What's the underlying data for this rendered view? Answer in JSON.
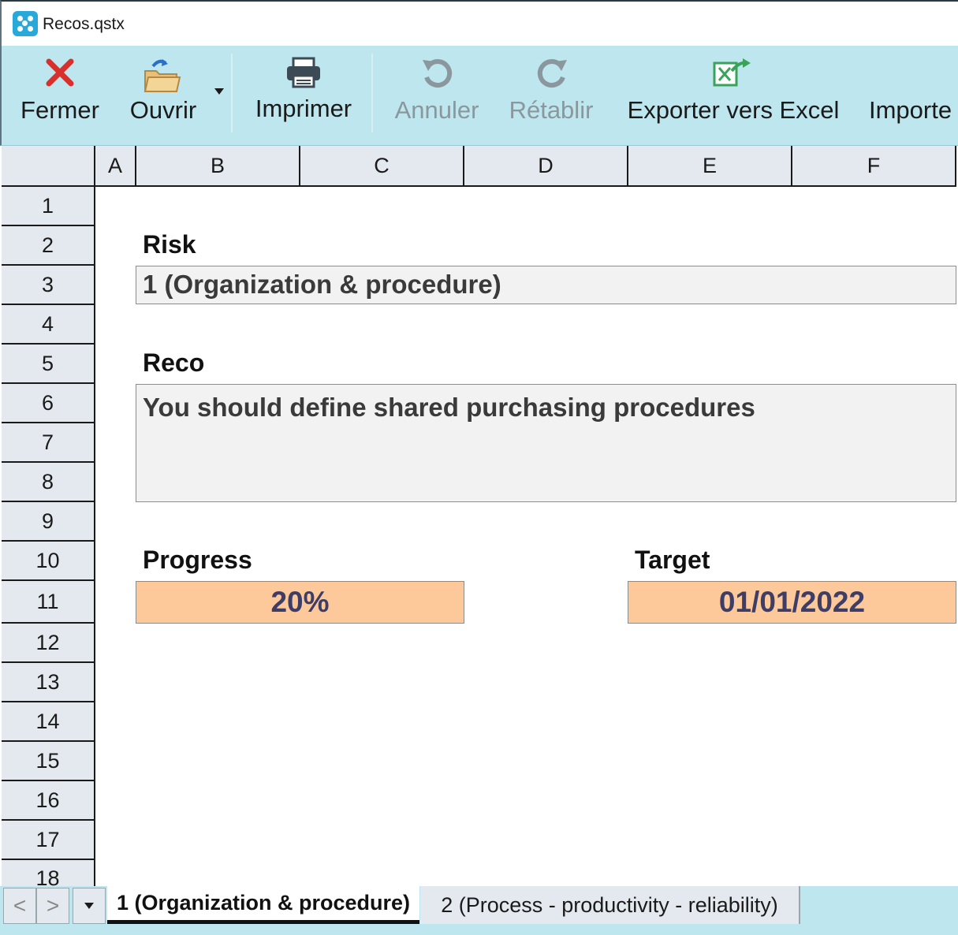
{
  "window": {
    "title": "Recos.qstx"
  },
  "toolbar": {
    "close_label": "Fermer",
    "open_label": "Ouvrir",
    "print_label": "Imprimer",
    "undo_label": "Annuler",
    "redo_label": "Rétablir",
    "export_label": "Exporter vers Excel",
    "import_label": "Importe"
  },
  "sheet": {
    "columns": [
      "A",
      "B",
      "C",
      "D",
      "E",
      "F"
    ],
    "rows": [
      "1",
      "2",
      "3",
      "4",
      "5",
      "6",
      "7",
      "8",
      "9",
      "10",
      "11",
      "12",
      "13",
      "14",
      "15",
      "16",
      "17",
      "18"
    ]
  },
  "form": {
    "risk_label": "Risk",
    "risk_value": "1 (Organization & procedure)",
    "reco_label": "Reco",
    "reco_value": "You should define shared purchasing procedures",
    "progress_label": "Progress",
    "progress_value": "20%",
    "target_label": "Target",
    "target_value": "01/01/2022"
  },
  "tabs": {
    "prev": "<",
    "next": ">",
    "items": [
      {
        "label": "1 (Organization & procedure)",
        "active": true
      },
      {
        "label": "2 (Process - productivity - reliability)",
        "active": false
      }
    ]
  },
  "colors": {
    "ribbon_bg": "#bde6ef",
    "field_bg": "#f2f2f2",
    "highlight_bg": "#fdc99b",
    "close_icon": "#d9302c",
    "export_icon": "#3aa35a"
  },
  "icons": [
    "app-icon",
    "close-icon",
    "open-folder-icon",
    "dropdown-arrow-icon",
    "printer-icon",
    "undo-icon",
    "redo-icon",
    "export-excel-icon"
  ]
}
